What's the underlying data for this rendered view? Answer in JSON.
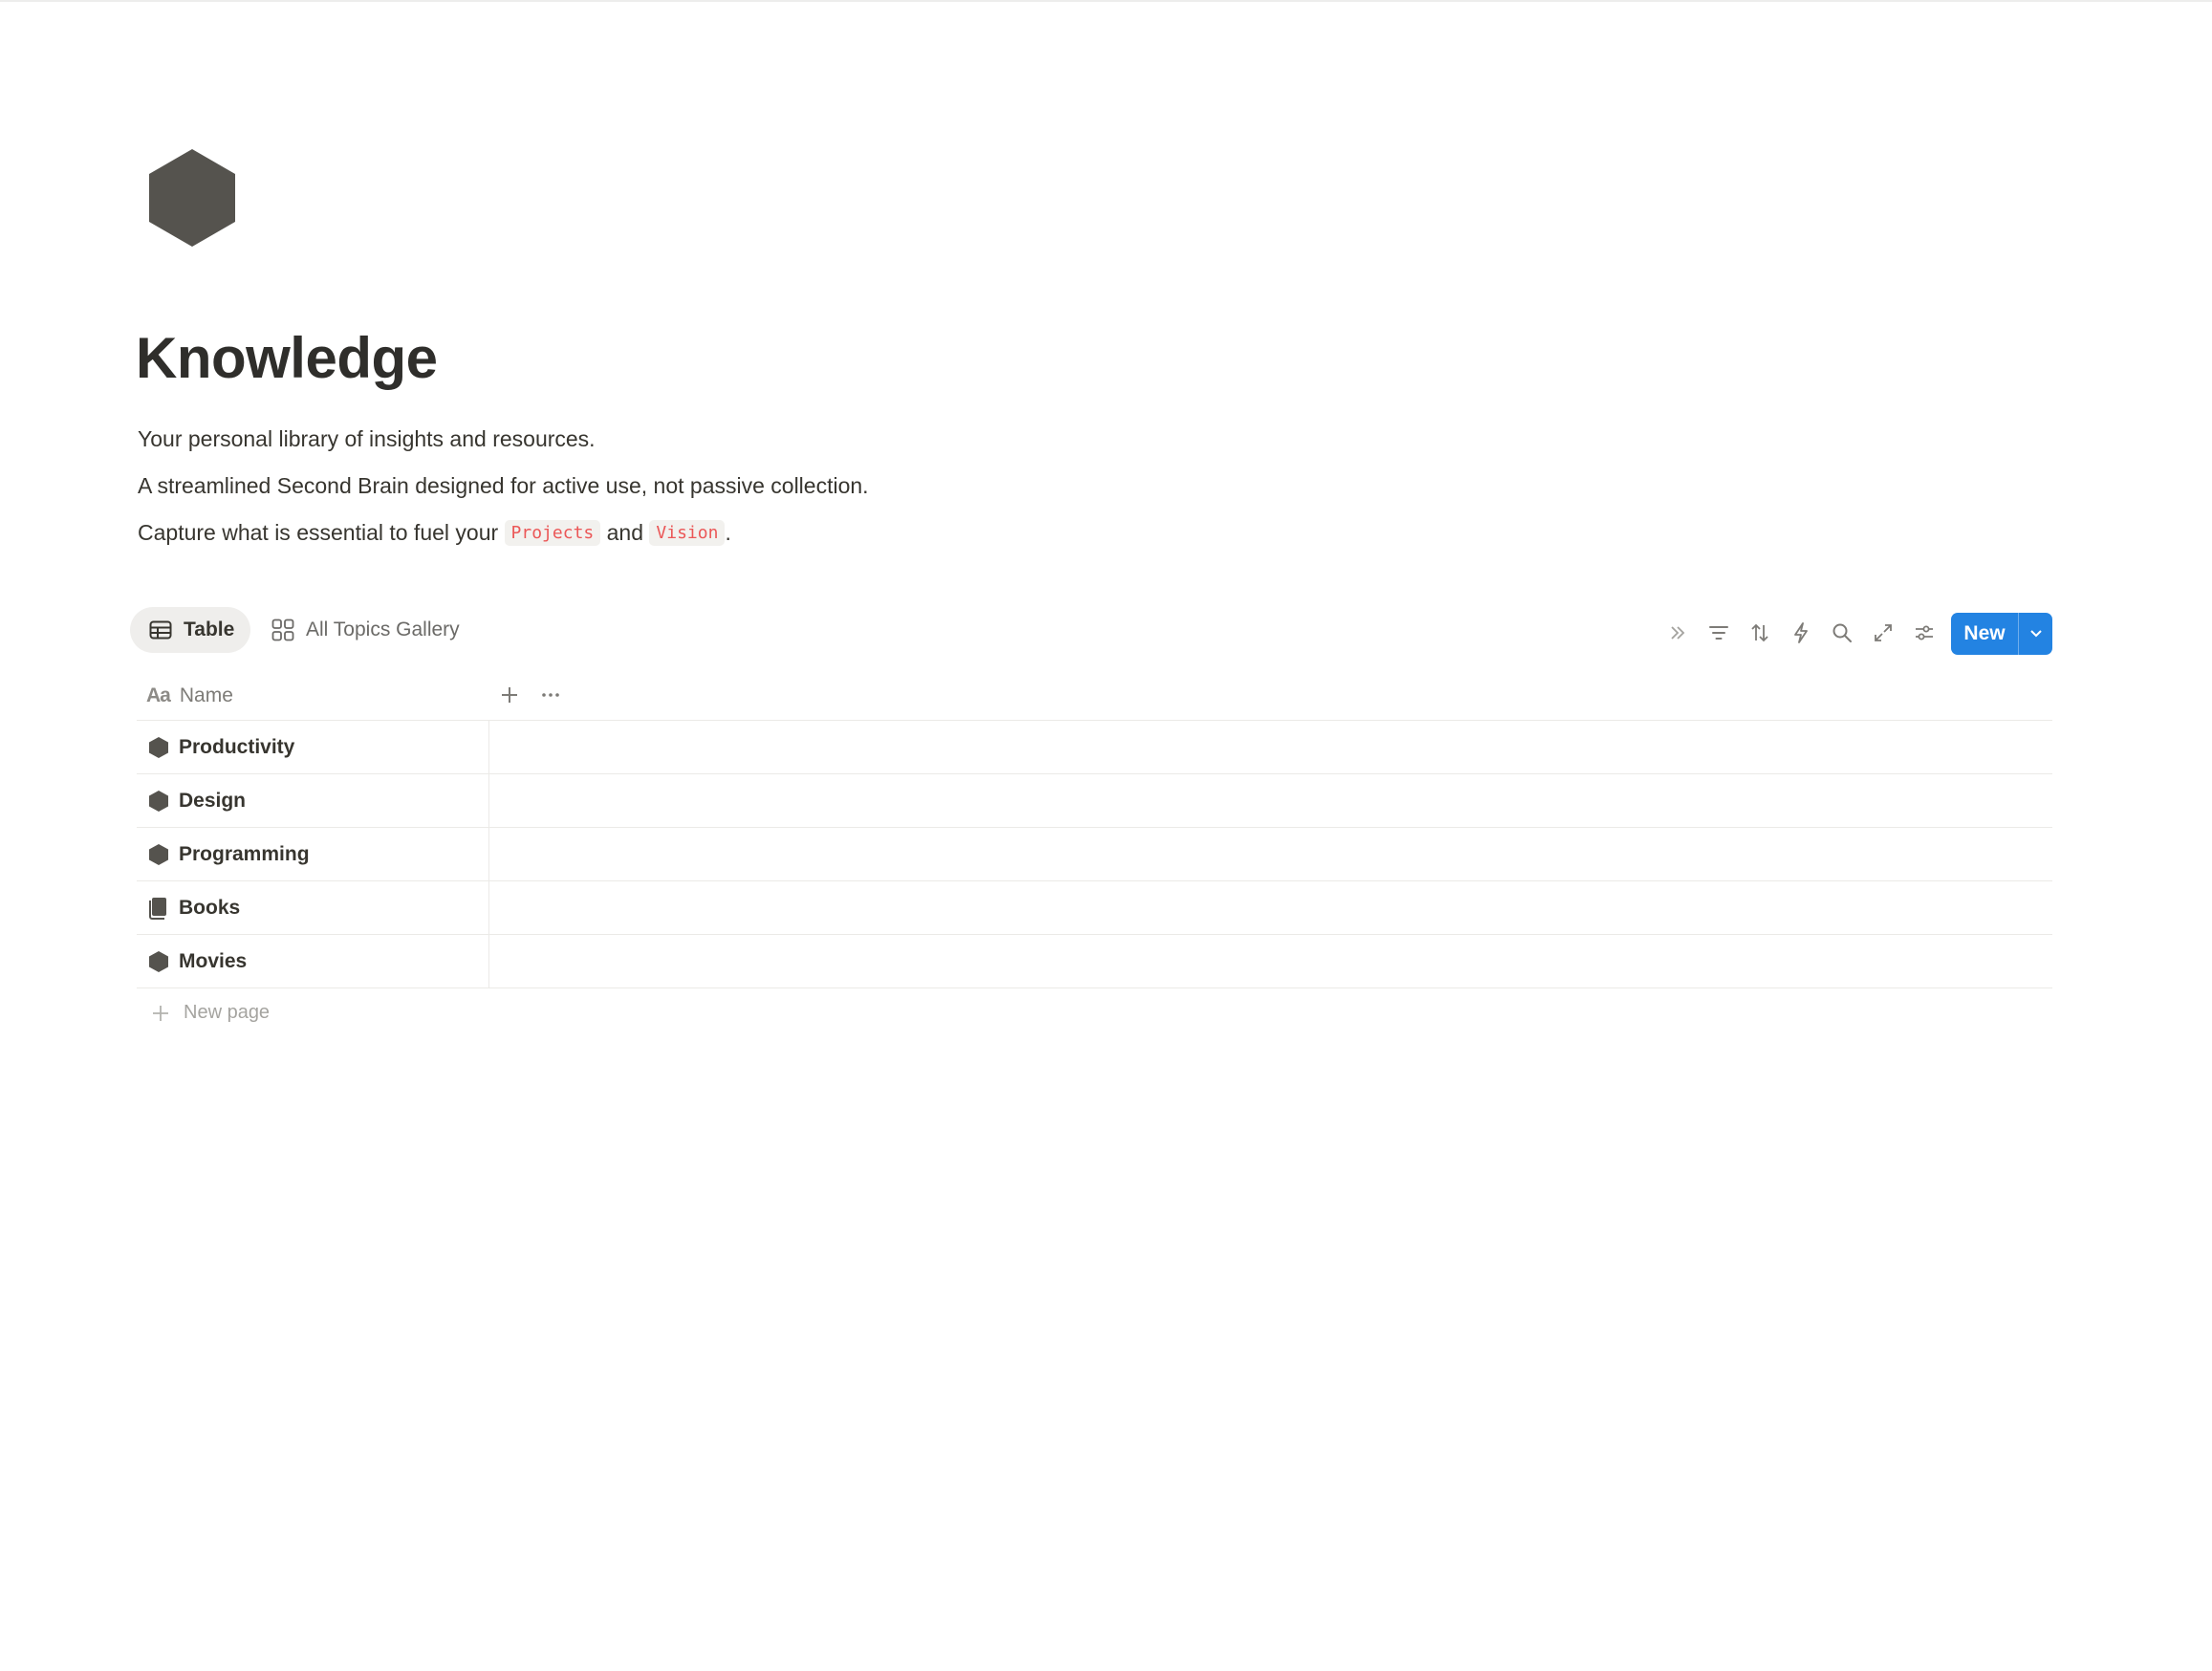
{
  "page": {
    "title": "Knowledge",
    "icon": "hexagon-icon",
    "description": [
      "Your personal library of insights and resources.",
      "A streamlined Second Brain designed for active use, not passive collection."
    ],
    "line3": {
      "prefix": "Capture what is essential to fuel your",
      "code1": "Projects",
      "middle": "and",
      "code2": "Vision",
      "suffix": "."
    }
  },
  "views": {
    "table_label": "Table",
    "gallery_label": "All Topics Gallery"
  },
  "toolbar": {
    "icons": [
      "double-chevron-icon",
      "filter-icon",
      "sort-icon",
      "lightning-icon",
      "search-icon",
      "expand-icon",
      "settings-sliders-icon"
    ],
    "new_label": "New"
  },
  "table": {
    "name_header": "Name",
    "name_header_icon": "Aa",
    "rows": [
      {
        "label": "Productivity",
        "icon": "hexagon-icon"
      },
      {
        "label": "Design",
        "icon": "hexagon-icon"
      },
      {
        "label": "Programming",
        "icon": "hexagon-icon"
      },
      {
        "label": "Books",
        "icon": "book-icon"
      },
      {
        "label": "Movies",
        "icon": "hexagon-icon"
      }
    ],
    "new_page_label": "New page"
  },
  "colors": {
    "accent": "#2383e2",
    "icon_dark": "#55534e",
    "code_text": "#eb5757",
    "border": "#ebeae7"
  }
}
